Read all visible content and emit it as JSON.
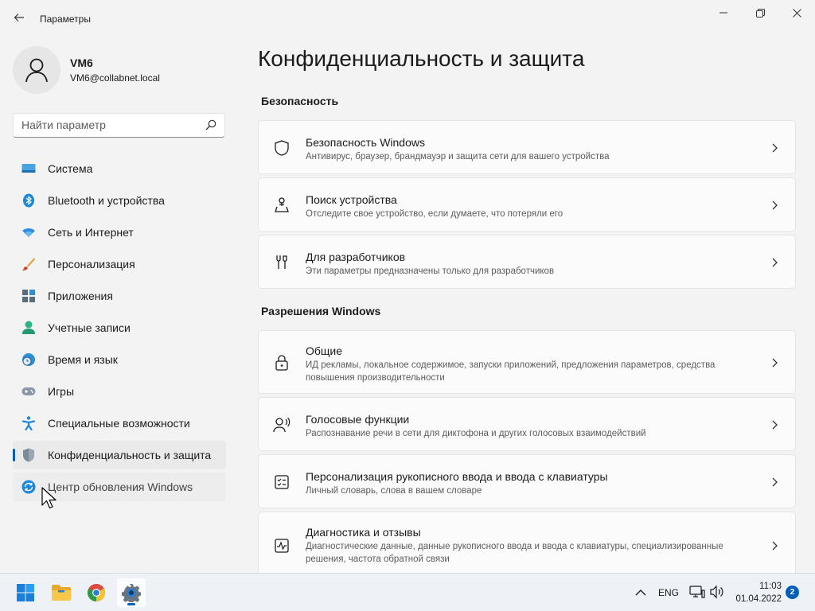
{
  "window": {
    "title": "Параметры",
    "back_icon": "back-arrow-icon",
    "minimize_icon": "minimize-icon",
    "maximize_icon": "restore-icon",
    "close_icon": "close-icon"
  },
  "user": {
    "name": "VM6",
    "email": "VM6@collabnet.local",
    "avatar_icon": "person-icon"
  },
  "search": {
    "placeholder": "Найти параметр",
    "value": "",
    "icon": "search-icon"
  },
  "sidebar": {
    "items": [
      {
        "label": "Система",
        "icon": "monitor-icon"
      },
      {
        "label": "Bluetooth и устройства",
        "icon": "bluetooth-icon"
      },
      {
        "label": "Сеть и Интернет",
        "icon": "wifi-icon"
      },
      {
        "label": "Персонализация",
        "icon": "brush-icon"
      },
      {
        "label": "Приложения",
        "icon": "apps-icon"
      },
      {
        "label": "Учетные записи",
        "icon": "account-icon"
      },
      {
        "label": "Время и язык",
        "icon": "clock-globe-icon"
      },
      {
        "label": "Игры",
        "icon": "gamepad-icon"
      },
      {
        "label": "Специальные возможности",
        "icon": "accessibility-icon"
      },
      {
        "label": "Конфиденциальность и защита",
        "icon": "shield-icon",
        "selected": true
      },
      {
        "label": "Центр обновления Windows",
        "icon": "update-icon",
        "hovered": true
      }
    ]
  },
  "main": {
    "title": "Конфиденциальность и защита",
    "sections": [
      {
        "heading": "Безопасность",
        "cards": [
          {
            "title": "Безопасность Windows",
            "subtitle": "Антивирус, браузер, брандмауэр и защита сети для вашего устройства",
            "icon": "shield-outline-icon"
          },
          {
            "title": "Поиск устройства",
            "subtitle": "Отследите свое устройство, если думаете, что потеряли его",
            "icon": "location-person-icon"
          },
          {
            "title": "Для разработчиков",
            "subtitle": "Эти параметры предназначены только для разработчиков",
            "icon": "developer-tools-icon"
          }
        ]
      },
      {
        "heading": "Разрешения Windows",
        "cards": [
          {
            "title": "Общие",
            "subtitle": "ИД рекламы, локальное содержимое, запуски приложений, предложения параметров, средства повышения производительности",
            "icon": "lock-icon"
          },
          {
            "title": "Голосовые функции",
            "subtitle": "Распознавание речи в сети для диктофона и других голосовых взаимодействий",
            "icon": "speech-icon"
          },
          {
            "title": "Персонализация рукописного ввода и ввода с клавиатуры",
            "subtitle": "Личный словарь, слова в вашем словаре",
            "icon": "checklist-icon"
          },
          {
            "title": "Диагностика и отзывы",
            "subtitle": "Диагностические данные, данные рукописного ввода и ввода с клавиатуры, специализированные решения, частота обратной связи",
            "icon": "diagnostics-icon"
          }
        ]
      }
    ]
  },
  "taskbar": {
    "apps": [
      {
        "name": "Start",
        "icon": "windows-start-icon"
      },
      {
        "name": "File Explorer",
        "icon": "folder-icon"
      },
      {
        "name": "Google Chrome",
        "icon": "chrome-icon"
      },
      {
        "name": "Settings",
        "icon": "settings-gear-icon",
        "active": true
      }
    ],
    "tray": {
      "language": "ENG",
      "time": "11:03",
      "date": "01.04.2022",
      "notification_count": "2"
    }
  },
  "colors": {
    "accent": "#005fb8",
    "window_bg": "#f3f3f3",
    "card_bg": "#fbfbfb",
    "taskbar_bg": "#eef1f6"
  }
}
